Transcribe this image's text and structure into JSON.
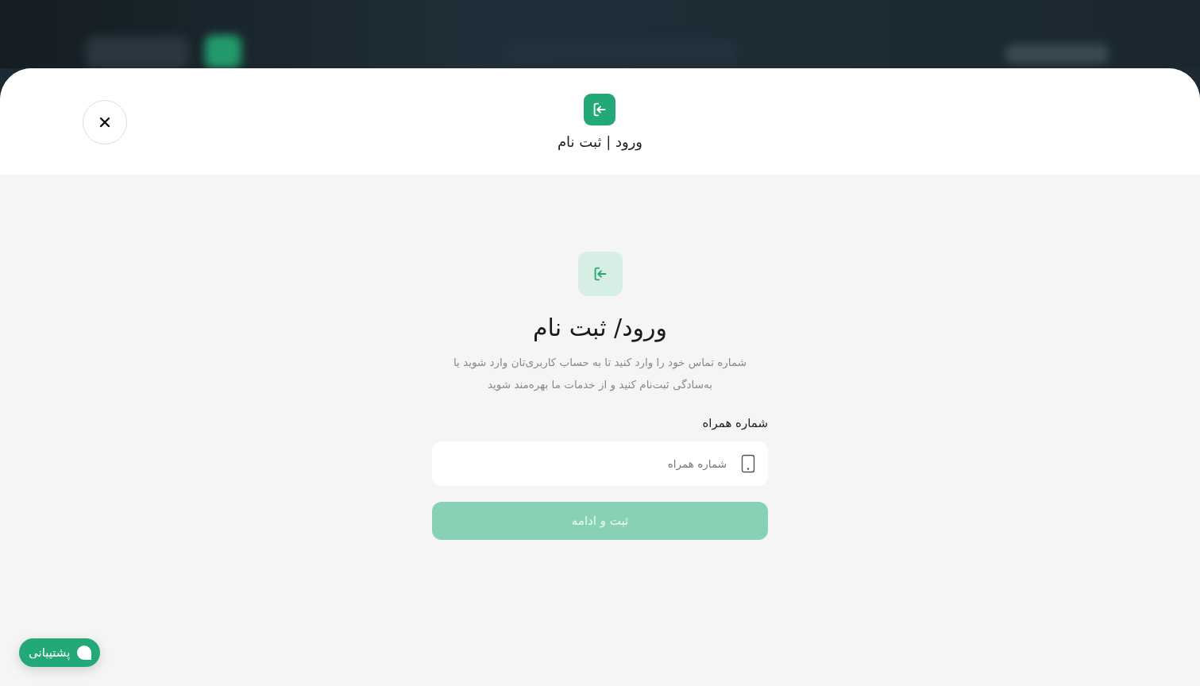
{
  "modal": {
    "title": "ورود | ثبت نام"
  },
  "form": {
    "heading": "ورود/ ثبت نام",
    "description": [
      "شماره تماس خود را وارد کنید تا به حساب کاربری‌تان وارد شوید یا",
      "به‌سادگی ثبت‌نام کنید و از خدمات ما بهره‌مند شوید"
    ],
    "phone": {
      "label": "شماره همراه",
      "placeholder": "شماره همراه"
    },
    "submit": {
      "label": "ثبت و ادامه",
      "disabled": true
    }
  },
  "support": {
    "label": "پشتیبانی"
  }
}
